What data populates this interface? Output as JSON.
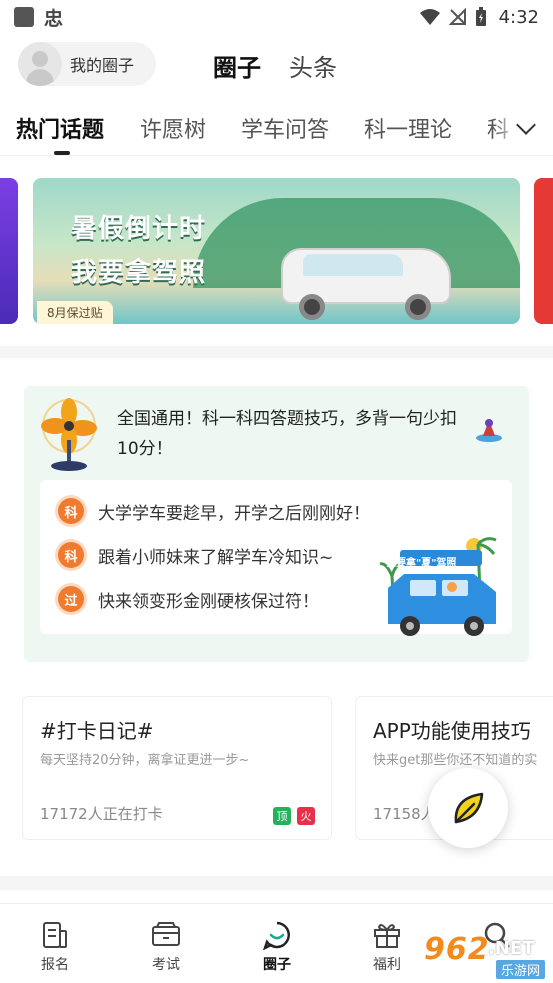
{
  "status_bar": {
    "app_glyph": "忠",
    "time": "4:32"
  },
  "header": {
    "my_circle_label": "我的圈子",
    "tabs": [
      {
        "label": "圈子",
        "active": true
      },
      {
        "label": "头条",
        "active": false
      }
    ]
  },
  "category_tabs": {
    "items": [
      {
        "label": "热门话题",
        "active": true
      },
      {
        "label": "许愿树"
      },
      {
        "label": "学车问答"
      },
      {
        "label": "科一理论"
      },
      {
        "label": "科"
      }
    ]
  },
  "banner": {
    "title_line1": "暑假倒计时",
    "title_line2": "我要拿驾照",
    "tag": "8月保过贴"
  },
  "promo": {
    "headline": "全国通用！科一科四答题技巧，多背一句少扣10分！",
    "items": [
      {
        "badge": "科",
        "text": "大学学车要趁早，开学之后刚刚好！"
      },
      {
        "badge": "科",
        "text": "跟着小师妹来了解学车冷知识~"
      },
      {
        "badge": "过",
        "text": "快来领变形金刚硬核保过符！"
      }
    ],
    "van_sign": "我要拿\"夏\"驾照"
  },
  "topics": [
    {
      "title": "#打卡日记#",
      "subtitle": "每天坚持20分钟，离拿证更进一步~",
      "count": "17172人正在打卡",
      "badge_top": "顶",
      "badge_hot": "火"
    },
    {
      "title": "APP功能使用技巧",
      "subtitle": "快来get那些你还不知道的实",
      "count": "17158人"
    }
  ],
  "bottom_nav": {
    "items": [
      {
        "label": "报名",
        "icon": "signup-icon"
      },
      {
        "label": "考试",
        "icon": "exam-icon"
      },
      {
        "label": "圈子",
        "icon": "circle-icon",
        "active": true
      },
      {
        "label": "福利",
        "icon": "gift-icon"
      },
      {
        "label": "",
        "icon": "search-icon"
      }
    ]
  },
  "watermark": {
    "number": "962",
    "net": ".NET",
    "subtitle": "乐游网"
  },
  "colors": {
    "accent_orange": "#f07a2e",
    "promo_bg": "#eef7f1",
    "top_green": "#22b35b",
    "hot_red": "#e8304a"
  }
}
